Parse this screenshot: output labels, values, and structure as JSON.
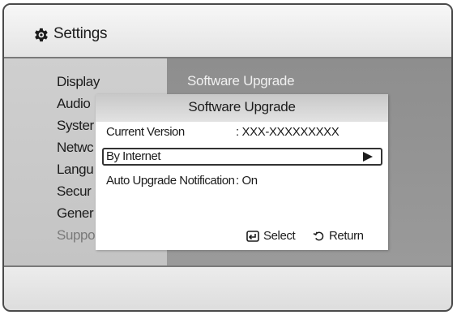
{
  "header": {
    "title": "Settings",
    "icon": "gear-icon"
  },
  "sidebar": {
    "items": [
      {
        "label": "Display"
      },
      {
        "label": "Audio"
      },
      {
        "label": "Syster"
      },
      {
        "label": "Netwc"
      },
      {
        "label": "Langu"
      },
      {
        "label": "Secur"
      },
      {
        "label": "Gener"
      },
      {
        "label": "Support"
      }
    ]
  },
  "main": {
    "section_title": "Software Upgrade"
  },
  "dialog": {
    "title": "Software Upgrade",
    "current_version_label": "Current Version",
    "current_version_value": ": XXX-XXXXXXXXX",
    "by_internet_label": "By Internet",
    "auto_upgrade_label": "Auto Upgrade Notification",
    "auto_upgrade_value": ": On",
    "select_label": "Select",
    "return_label": "Return"
  },
  "colors": {
    "highlight_border": "#333333",
    "panel_right": "#8e8e8e",
    "panel_left": "#cfcfcf"
  }
}
